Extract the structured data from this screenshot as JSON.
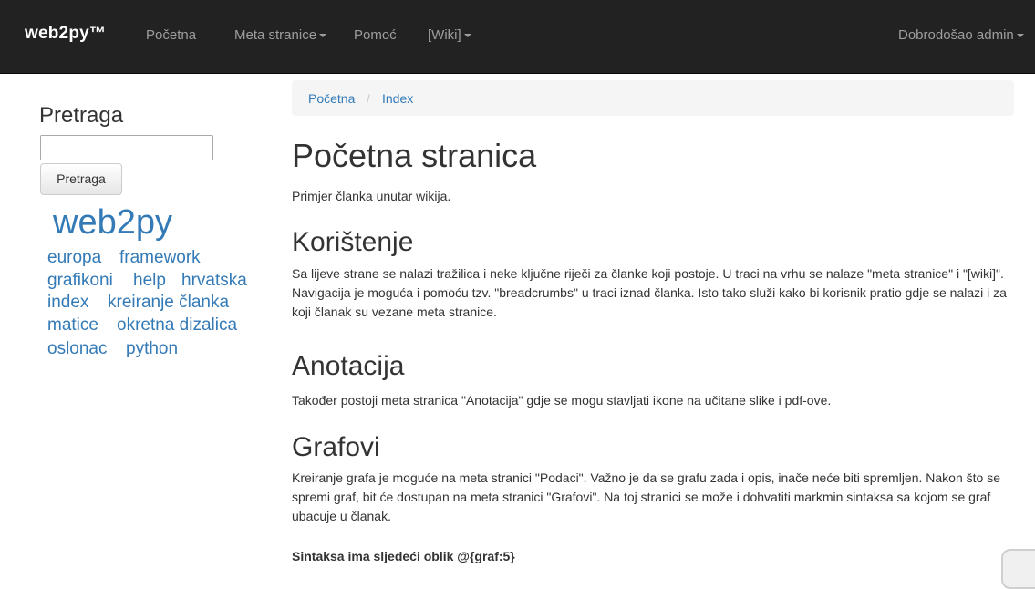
{
  "navbar": {
    "brand": "web2py",
    "brand_tm": "™",
    "items": [
      {
        "label": "Početna",
        "dropdown": false
      },
      {
        "label": "Meta stranice",
        "dropdown": true
      },
      {
        "label": "Pomoć",
        "dropdown": false
      },
      {
        "label": "[Wiki]",
        "dropdown": true
      }
    ],
    "user": "Dobrodošao admin"
  },
  "sidebar": {
    "title": "Pretraga",
    "search_value": "",
    "search_button": "Pretraga",
    "tags": [
      "web2py",
      "europa",
      "framework",
      "grafikoni",
      "help",
      "hrvatska",
      "index",
      "kreiranje članka",
      "matice",
      "okretna dizalica",
      "oslonac",
      "python"
    ]
  },
  "breadcrumb": {
    "items": [
      "Početna",
      "Index"
    ],
    "separator": "/"
  },
  "article": {
    "title": "Početna stranica",
    "intro": "Primjer članka unutar wikija.",
    "sections": [
      {
        "heading": "Korištenje",
        "text": "Sa lijeve strane se nalazi tražilica i neke ključne riječi za članke koji postoje. U traci na vrhu se nalaze \"meta stranice\" i \"[wiki]\". Navigacija je moguća i pomoću tzv. \"breadcrumbs\" u traci iznad članka. Isto tako služi kako bi korisnik pratio gdje se nalazi i za koji članak su vezane meta stranice."
      },
      {
        "heading": "Anotacija",
        "text": "Također postoji meta stranica \"Anotacija\" gdje se mogu stavljati ikone na učitane slike i pdf-ove."
      },
      {
        "heading": "Grafovi",
        "text": "Kreiranje grafa je moguće na meta stranici \"Podaci\". Važno je da se grafu zada i opis, inače neće biti spremljen. Nakon što se spremi graf, bit će dostupan na meta stranici \"Grafovi\". Na toj stranici se može i dohvatiti markmin sintaksa sa kojom se graf ubacuje u članak."
      }
    ],
    "syntax_note": "Sintaksa ima sljedeći oblik @{graf:5}"
  },
  "colors": {
    "navbar_bg": "#222222",
    "nav_text": "#9d9d9d",
    "link": "#337ab7",
    "breadcrumb_bg": "#f5f5f5"
  }
}
